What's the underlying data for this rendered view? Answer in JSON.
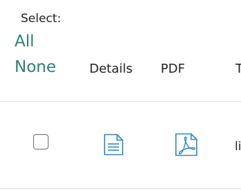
{
  "selection": {
    "label": "Select:",
    "all_link": "All",
    "none_link": "None"
  },
  "columns": {
    "details": "Details",
    "pdf": "PDF",
    "title": "T"
  },
  "rows": [
    {
      "checked": false,
      "details_icon": "document-icon",
      "pdf_icon": "pdf-icon",
      "title_fragment": "li"
    }
  ],
  "colors": {
    "accent": "#2e7f74",
    "icon": "#2f86c4",
    "divider": "#dcdcdc"
  }
}
